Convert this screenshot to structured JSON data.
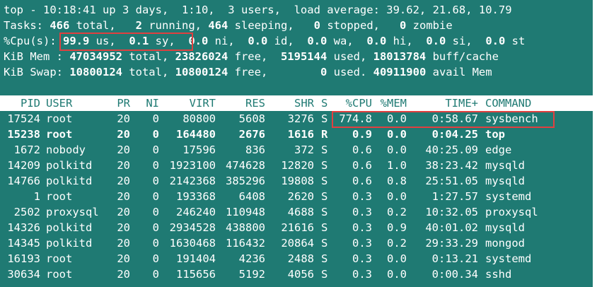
{
  "summary": {
    "line1": "top - 10:18:41 up 3 days,  1:10,  3 users,  load average: 39.62, 21.68, 10.79",
    "line2_parts": [
      "Tasks: ",
      "466",
      " total,   ",
      "2",
      " running, ",
      "464",
      " sleeping,   ",
      "0",
      " stopped,   ",
      "0",
      " zombie"
    ],
    "line3_parts": [
      "%Cpu(s): ",
      "99.9",
      " us,  ",
      "0.1",
      " sy,  ",
      "0.0",
      " ni,  ",
      "0.0",
      " id,  ",
      "0.0",
      " wa,  ",
      "0.0",
      " hi,  ",
      "0.0",
      " si,  ",
      "0.0",
      " st"
    ],
    "line4_parts": [
      "KiB Mem : ",
      "47034952",
      " total, ",
      "23826024",
      " free,  ",
      "5195144",
      " used, ",
      "18013784",
      " buff/cache"
    ],
    "line5_parts": [
      "KiB Swap: ",
      "10800124",
      " total, ",
      "10800124",
      " free,        ",
      "0",
      " used. ",
      "40911900",
      " avail Mem"
    ]
  },
  "columns": [
    "PID",
    "USER",
    "PR",
    "NI",
    "VIRT",
    "RES",
    "SHR",
    "S",
    "%CPU",
    "%MEM",
    "TIME+",
    "COMMAND"
  ],
  "processes": [
    {
      "pid": "17524",
      "user": "root",
      "pr": "20",
      "ni": "0",
      "virt": "80800",
      "res": "5608",
      "shr": "3276",
      "s": "S",
      "cpu": "774.8",
      "mem": "0.0",
      "time": "0:58.67",
      "cmd": "sysbench",
      "bold": false
    },
    {
      "pid": "15238",
      "user": "root",
      "pr": "20",
      "ni": "0",
      "virt": "164480",
      "res": "2676",
      "shr": "1616",
      "s": "R",
      "cpu": "0.9",
      "mem": "0.0",
      "time": "0:04.25",
      "cmd": "top",
      "bold": true
    },
    {
      "pid": "1672",
      "user": "nobody",
      "pr": "20",
      "ni": "0",
      "virt": "17596",
      "res": "836",
      "shr": "372",
      "s": "S",
      "cpu": "0.6",
      "mem": "0.0",
      "time": "40:25.09",
      "cmd": "edge",
      "bold": false
    },
    {
      "pid": "14209",
      "user": "polkitd",
      "pr": "20",
      "ni": "0",
      "virt": "1923100",
      "res": "474628",
      "shr": "12820",
      "s": "S",
      "cpu": "0.6",
      "mem": "1.0",
      "time": "38:23.42",
      "cmd": "mysqld",
      "bold": false
    },
    {
      "pid": "14766",
      "user": "polkitd",
      "pr": "20",
      "ni": "0",
      "virt": "2142368",
      "res": "385296",
      "shr": "19808",
      "s": "S",
      "cpu": "0.6",
      "mem": "0.8",
      "time": "25:51.05",
      "cmd": "mysqld",
      "bold": false
    },
    {
      "pid": "1",
      "user": "root",
      "pr": "20",
      "ni": "0",
      "virt": "193368",
      "res": "6408",
      "shr": "2620",
      "s": "S",
      "cpu": "0.3",
      "mem": "0.0",
      "time": "1:27.57",
      "cmd": "systemd",
      "bold": false
    },
    {
      "pid": "2502",
      "user": "proxysql",
      "pr": "20",
      "ni": "0",
      "virt": "246240",
      "res": "110948",
      "shr": "4688",
      "s": "S",
      "cpu": "0.3",
      "mem": "0.2",
      "time": "10:32.05",
      "cmd": "proxysql",
      "bold": false
    },
    {
      "pid": "14326",
      "user": "polkitd",
      "pr": "20",
      "ni": "0",
      "virt": "2934528",
      "res": "438800",
      "shr": "21616",
      "s": "S",
      "cpu": "0.3",
      "mem": "0.9",
      "time": "40:01.02",
      "cmd": "mysqld",
      "bold": false
    },
    {
      "pid": "14345",
      "user": "polkitd",
      "pr": "20",
      "ni": "0",
      "virt": "1630468",
      "res": "116432",
      "shr": "20864",
      "s": "S",
      "cpu": "0.3",
      "mem": "0.2",
      "time": "29:33.29",
      "cmd": "mongod",
      "bold": false
    },
    {
      "pid": "16193",
      "user": "root",
      "pr": "20",
      "ni": "0",
      "virt": "191404",
      "res": "4236",
      "shr": "2488",
      "s": "S",
      "cpu": "0.3",
      "mem": "0.0",
      "time": "0:13.21",
      "cmd": "systemd",
      "bold": false
    },
    {
      "pid": "30634",
      "user": "root",
      "pr": "20",
      "ni": "0",
      "virt": "115656",
      "res": "5192",
      "shr": "4056",
      "s": "S",
      "cpu": "0.3",
      "mem": "0.0",
      "time": "0:00.34",
      "cmd": "sshd",
      "bold": false
    }
  ],
  "colors": {
    "terminal_bg": "#1f7a73",
    "text": "#ffffff",
    "highlight_box": "#e04040"
  }
}
